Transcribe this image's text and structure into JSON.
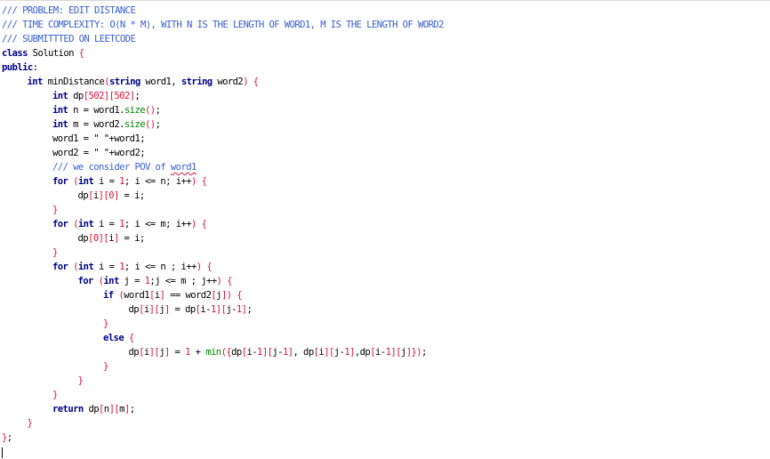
{
  "code": {
    "lines": [
      {
        "indent": 0,
        "tokens": [
          {
            "t": "/// PROBLEM: EDIT DISTANCE",
            "c": "comment"
          }
        ]
      },
      {
        "indent": 0,
        "tokens": [
          {
            "t": "/// TIME COMPLEXITY: O(N * M), WITH N IS THE LENGTH OF WORD1, M IS THE LENGTH OF WORD2",
            "c": "comment"
          }
        ]
      },
      {
        "indent": 0,
        "tokens": [
          {
            "t": "/// SUBMITTTED ON LEETCODE",
            "c": "comment"
          }
        ]
      },
      {
        "indent": 0,
        "tokens": [
          {
            "t": "class",
            "c": "keyword"
          },
          {
            "t": " Solution ",
            "c": "default"
          },
          {
            "t": "{",
            "c": "punct"
          }
        ]
      },
      {
        "indent": 0,
        "tokens": [
          {
            "t": "public",
            "c": "keyword"
          },
          {
            "t": ":",
            "c": "default"
          }
        ]
      },
      {
        "indent": 1,
        "tokens": [
          {
            "t": "int",
            "c": "keyword"
          },
          {
            "t": " minDistance",
            "c": "default"
          },
          {
            "t": "(",
            "c": "punct"
          },
          {
            "t": "string",
            "c": "keyword"
          },
          {
            "t": " word1, ",
            "c": "default"
          },
          {
            "t": "string",
            "c": "keyword"
          },
          {
            "t": " word2",
            "c": "default"
          },
          {
            "t": ")",
            "c": "punct"
          },
          {
            "t": " ",
            "c": "default"
          },
          {
            "t": "{",
            "c": "punct"
          }
        ]
      },
      {
        "indent": 2,
        "tokens": [
          {
            "t": "int",
            "c": "keyword"
          },
          {
            "t": " dp",
            "c": "default"
          },
          {
            "t": "[502][502]",
            "c": "punct"
          },
          {
            "t": ";",
            "c": "default"
          }
        ]
      },
      {
        "indent": 2,
        "tokens": [
          {
            "t": "int",
            "c": "keyword"
          },
          {
            "t": " n = word1.",
            "c": "default"
          },
          {
            "t": "size",
            "c": "func"
          },
          {
            "t": "()",
            "c": "punct"
          },
          {
            "t": ";",
            "c": "default"
          }
        ]
      },
      {
        "indent": 2,
        "tokens": [
          {
            "t": "int",
            "c": "keyword"
          },
          {
            "t": " m = word2.",
            "c": "default"
          },
          {
            "t": "size",
            "c": "func"
          },
          {
            "t": "()",
            "c": "punct"
          },
          {
            "t": ";",
            "c": "default"
          }
        ]
      },
      {
        "indent": 2,
        "tokens": [
          {
            "t": "word1 = \" \"+word1;",
            "c": "default"
          }
        ]
      },
      {
        "indent": 2,
        "tokens": [
          {
            "t": "word2 = \" \"+word2;",
            "c": "default"
          }
        ]
      },
      {
        "indent": 2,
        "tokens": [
          {
            "t": "/// we consider POV of ",
            "c": "comment"
          },
          {
            "t": "word1",
            "c": "comment",
            "squiggle": true
          }
        ]
      },
      {
        "indent": 2,
        "tokens": [
          {
            "t": "for",
            "c": "keyword"
          },
          {
            "t": " ",
            "c": "default"
          },
          {
            "t": "(",
            "c": "punct"
          },
          {
            "t": "int",
            "c": "keyword"
          },
          {
            "t": " i = ",
            "c": "default"
          },
          {
            "t": "1",
            "c": "number"
          },
          {
            "t": "; i <= n; i++",
            "c": "default"
          },
          {
            "t": ")",
            "c": "punct"
          },
          {
            "t": " ",
            "c": "default"
          },
          {
            "t": "{",
            "c": "punct"
          }
        ]
      },
      {
        "indent": 3,
        "tokens": [
          {
            "t": "dp",
            "c": "default"
          },
          {
            "t": "[",
            "c": "punct"
          },
          {
            "t": "i",
            "c": "default"
          },
          {
            "t": "][0]",
            "c": "punct"
          },
          {
            "t": " = i;",
            "c": "default"
          }
        ]
      },
      {
        "indent": 2,
        "tokens": [
          {
            "t": "}",
            "c": "punct"
          }
        ]
      },
      {
        "indent": 2,
        "tokens": [
          {
            "t": "for",
            "c": "keyword"
          },
          {
            "t": " ",
            "c": "default"
          },
          {
            "t": "(",
            "c": "punct"
          },
          {
            "t": "int",
            "c": "keyword"
          },
          {
            "t": " i = ",
            "c": "default"
          },
          {
            "t": "1",
            "c": "number"
          },
          {
            "t": "; i <= m; i++",
            "c": "default"
          },
          {
            "t": ")",
            "c": "punct"
          },
          {
            "t": " ",
            "c": "default"
          },
          {
            "t": "{",
            "c": "punct"
          }
        ]
      },
      {
        "indent": 3,
        "tokens": [
          {
            "t": "dp",
            "c": "default"
          },
          {
            "t": "[0][",
            "c": "punct"
          },
          {
            "t": "i",
            "c": "default"
          },
          {
            "t": "]",
            "c": "punct"
          },
          {
            "t": " = i;",
            "c": "default"
          }
        ]
      },
      {
        "indent": 2,
        "tokens": [
          {
            "t": "}",
            "c": "punct"
          }
        ]
      },
      {
        "indent": 2,
        "tokens": [
          {
            "t": "for",
            "c": "keyword"
          },
          {
            "t": " ",
            "c": "default"
          },
          {
            "t": "(",
            "c": "punct"
          },
          {
            "t": "int",
            "c": "keyword"
          },
          {
            "t": " i = ",
            "c": "default"
          },
          {
            "t": "1",
            "c": "number"
          },
          {
            "t": "; i <= n ; i++",
            "c": "default"
          },
          {
            "t": ")",
            "c": "punct"
          },
          {
            "t": " ",
            "c": "default"
          },
          {
            "t": "{",
            "c": "punct"
          }
        ]
      },
      {
        "indent": 3,
        "tokens": [
          {
            "t": "for",
            "c": "keyword"
          },
          {
            "t": " ",
            "c": "default"
          },
          {
            "t": "(",
            "c": "punct"
          },
          {
            "t": "int",
            "c": "keyword"
          },
          {
            "t": " j = ",
            "c": "default"
          },
          {
            "t": "1",
            "c": "number"
          },
          {
            "t": ";j <= m ; j++",
            "c": "default"
          },
          {
            "t": ")",
            "c": "punct"
          },
          {
            "t": " ",
            "c": "default"
          },
          {
            "t": "{",
            "c": "punct"
          }
        ]
      },
      {
        "indent": 4,
        "tokens": [
          {
            "t": "if",
            "c": "keyword"
          },
          {
            "t": " ",
            "c": "default"
          },
          {
            "t": "(",
            "c": "punct"
          },
          {
            "t": "word1",
            "c": "default"
          },
          {
            "t": "[",
            "c": "punct"
          },
          {
            "t": "i",
            "c": "default"
          },
          {
            "t": "]",
            "c": "punct"
          },
          {
            "t": " == word2",
            "c": "default"
          },
          {
            "t": "[",
            "c": "punct"
          },
          {
            "t": "j",
            "c": "default"
          },
          {
            "t": "])",
            "c": "punct"
          },
          {
            "t": " ",
            "c": "default"
          },
          {
            "t": "{",
            "c": "punct"
          }
        ]
      },
      {
        "indent": 5,
        "tokens": [
          {
            "t": "dp",
            "c": "default"
          },
          {
            "t": "[",
            "c": "punct"
          },
          {
            "t": "i",
            "c": "default"
          },
          {
            "t": "][",
            "c": "punct"
          },
          {
            "t": "j",
            "c": "default"
          },
          {
            "t": "]",
            "c": "punct"
          },
          {
            "t": " = dp",
            "c": "default"
          },
          {
            "t": "[",
            "c": "punct"
          },
          {
            "t": "i-",
            "c": "default"
          },
          {
            "t": "1",
            "c": "number"
          },
          {
            "t": "][",
            "c": "punct"
          },
          {
            "t": "j-",
            "c": "default"
          },
          {
            "t": "1",
            "c": "number"
          },
          {
            "t": "]",
            "c": "punct"
          },
          {
            "t": ";",
            "c": "default"
          }
        ]
      },
      {
        "indent": 4,
        "tokens": [
          {
            "t": "}",
            "c": "punct"
          }
        ]
      },
      {
        "indent": 4,
        "tokens": [
          {
            "t": "else",
            "c": "keyword"
          },
          {
            "t": " ",
            "c": "default"
          },
          {
            "t": "{",
            "c": "punct"
          }
        ]
      },
      {
        "indent": 5,
        "tokens": [
          {
            "t": "dp",
            "c": "default"
          },
          {
            "t": "[",
            "c": "punct"
          },
          {
            "t": "i",
            "c": "default"
          },
          {
            "t": "][",
            "c": "punct"
          },
          {
            "t": "j",
            "c": "default"
          },
          {
            "t": "]",
            "c": "punct"
          },
          {
            "t": " = ",
            "c": "default"
          },
          {
            "t": "1",
            "c": "number"
          },
          {
            "t": " + ",
            "c": "default"
          },
          {
            "t": "min",
            "c": "func"
          },
          {
            "t": "({",
            "c": "punct"
          },
          {
            "t": "dp",
            "c": "default"
          },
          {
            "t": "[",
            "c": "punct"
          },
          {
            "t": "i-",
            "c": "default"
          },
          {
            "t": "1",
            "c": "number"
          },
          {
            "t": "][",
            "c": "punct"
          },
          {
            "t": "j-",
            "c": "default"
          },
          {
            "t": "1",
            "c": "number"
          },
          {
            "t": "]",
            "c": "punct"
          },
          {
            "t": ", dp",
            "c": "default"
          },
          {
            "t": "[",
            "c": "punct"
          },
          {
            "t": "i",
            "c": "default"
          },
          {
            "t": "][",
            "c": "punct"
          },
          {
            "t": "j-",
            "c": "default"
          },
          {
            "t": "1",
            "c": "number"
          },
          {
            "t": "]",
            "c": "punct"
          },
          {
            "t": ",dp",
            "c": "default"
          },
          {
            "t": "[",
            "c": "punct"
          },
          {
            "t": "i-",
            "c": "default"
          },
          {
            "t": "1",
            "c": "number"
          },
          {
            "t": "][",
            "c": "punct"
          },
          {
            "t": "j",
            "c": "default"
          },
          {
            "t": "]})",
            "c": "punct"
          },
          {
            "t": ";",
            "c": "default"
          }
        ]
      },
      {
        "indent": 4,
        "tokens": [
          {
            "t": "}",
            "c": "punct"
          }
        ]
      },
      {
        "indent": 3,
        "tokens": [
          {
            "t": "}",
            "c": "punct"
          }
        ]
      },
      {
        "indent": 2,
        "tokens": [
          {
            "t": "}",
            "c": "punct"
          }
        ]
      },
      {
        "indent": 2,
        "tokens": [
          {
            "t": "return",
            "c": "keyword"
          },
          {
            "t": " dp",
            "c": "default"
          },
          {
            "t": "[",
            "c": "punct"
          },
          {
            "t": "n",
            "c": "default"
          },
          {
            "t": "][",
            "c": "punct"
          },
          {
            "t": "m",
            "c": "default"
          },
          {
            "t": "]",
            "c": "punct"
          },
          {
            "t": ";",
            "c": "default"
          }
        ]
      },
      {
        "indent": 1,
        "tokens": [
          {
            "t": "}",
            "c": "punct"
          }
        ]
      },
      {
        "indent": 0,
        "tokens": [
          {
            "t": "}",
            "c": "punct"
          },
          {
            "t": ";",
            "c": "default"
          }
        ]
      }
    ]
  },
  "colors": {
    "comment": "#3a5fcd",
    "keyword": "#00008b",
    "punct_and_numbers": "#dc143c",
    "function": "#008000",
    "text": "#000000",
    "background": "#ffffff"
  }
}
